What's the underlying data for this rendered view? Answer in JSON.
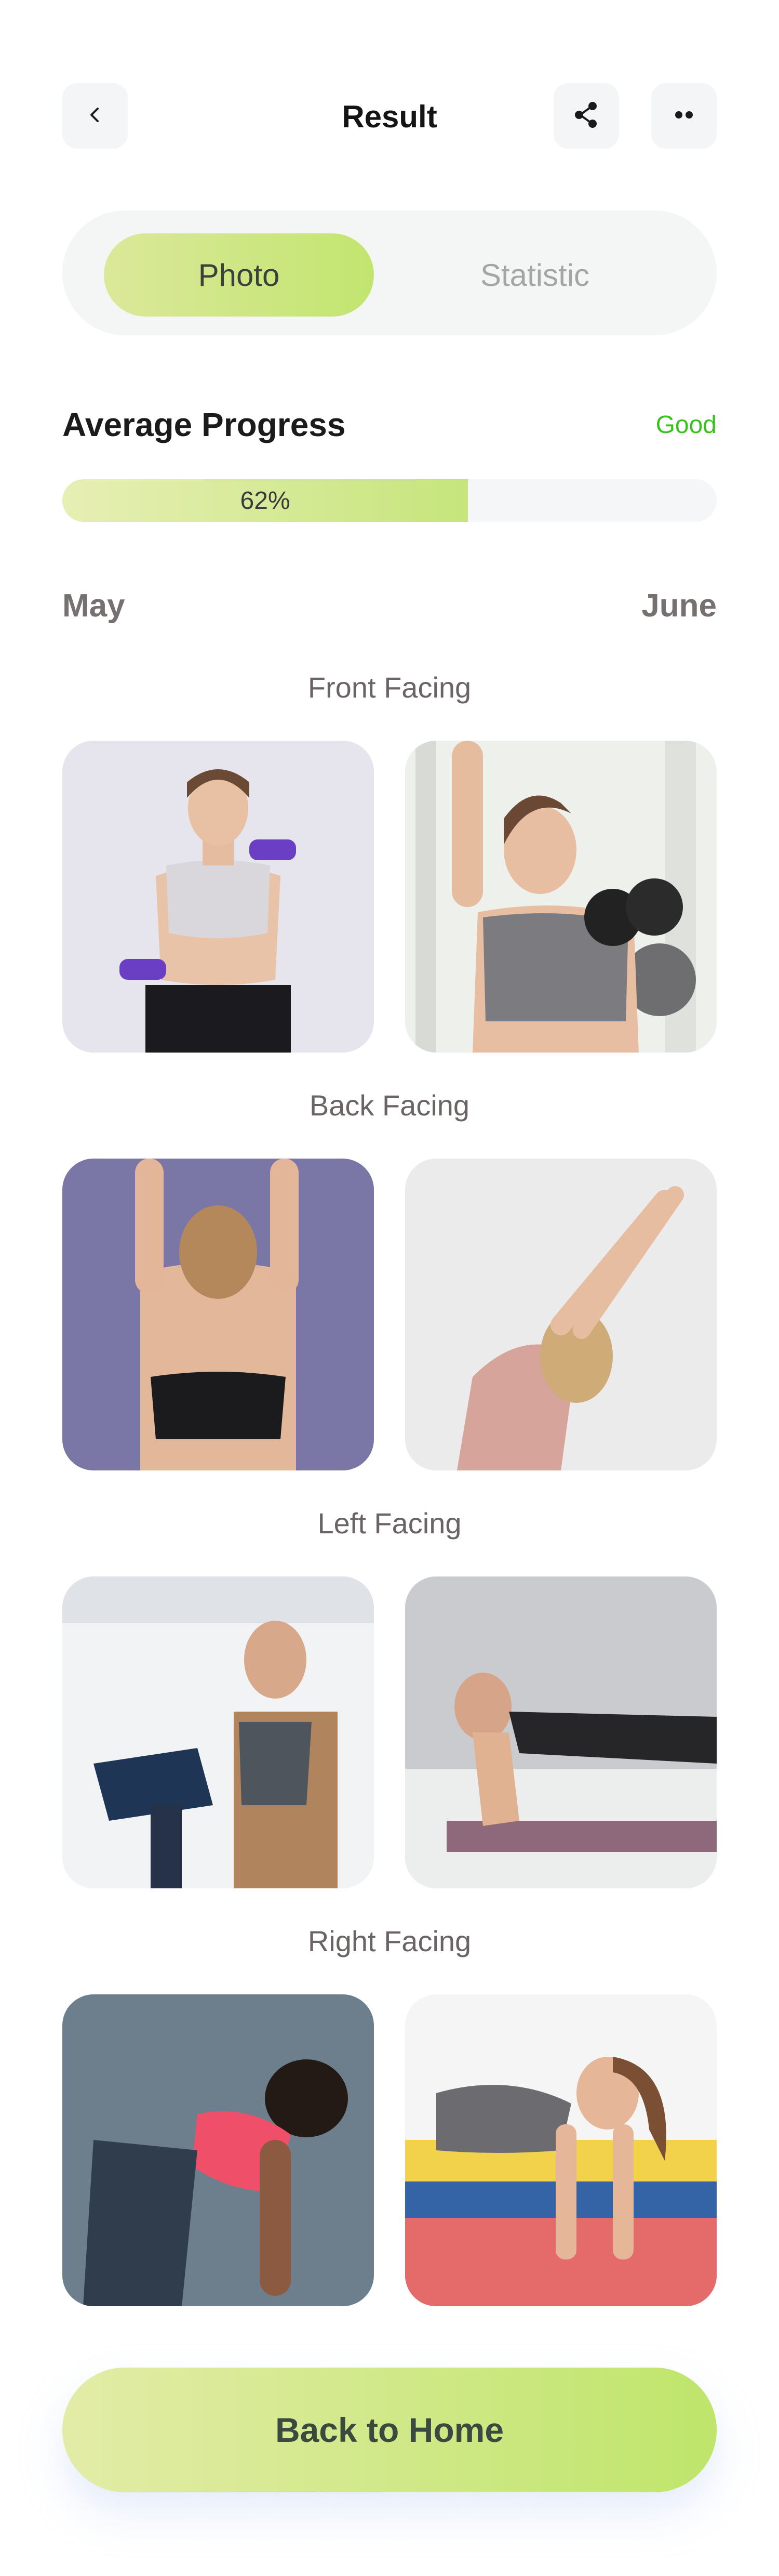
{
  "header": {
    "title": "Result",
    "back_icon": "chevron-left-icon",
    "share_icon": "share-icon",
    "more_icon": "more-dots-icon"
  },
  "tabs": [
    {
      "label": "Photo",
      "active": true
    },
    {
      "label": "Statistic",
      "active": false
    }
  ],
  "progress": {
    "title": "Average Progress",
    "status": "Good",
    "percent_label": "62%",
    "fraction": 0.62
  },
  "months": {
    "from": "May",
    "to": "June"
  },
  "sections": [
    {
      "label": "Front Facing"
    },
    {
      "label": "Back Facing"
    },
    {
      "label": "Left Facing"
    },
    {
      "label": "Right Facing"
    }
  ],
  "cta": {
    "label": "Back to Home"
  },
  "colors": {
    "accent_start": "#dbe89a",
    "accent_end": "#c2e56f",
    "good_status": "#38c21d"
  }
}
